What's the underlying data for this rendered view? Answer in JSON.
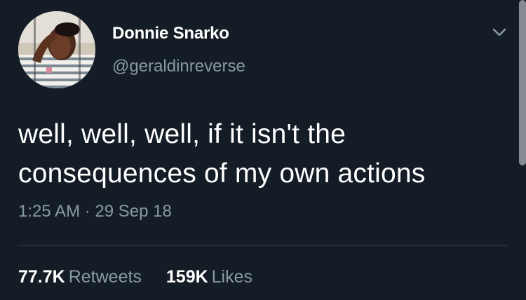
{
  "tweet": {
    "display_name": "Donnie Snarko",
    "handle": "@geraldinreverse",
    "text_lines": [
      "well, well, well, if it isn't the",
      "consequences of my own actions"
    ],
    "time": "1:25 AM",
    "separator": "·",
    "date": "29 Sep 18",
    "retweets": {
      "count": "77.7K",
      "label": "Retweets"
    },
    "likes": {
      "count": "159K",
      "label": "Likes"
    }
  },
  "icons": {
    "menu": "chevron-down-icon"
  },
  "colors": {
    "background": "#141d26",
    "primary_text": "#ffffff",
    "secondary_text": "#8899a6",
    "divider": "#2b3640"
  }
}
